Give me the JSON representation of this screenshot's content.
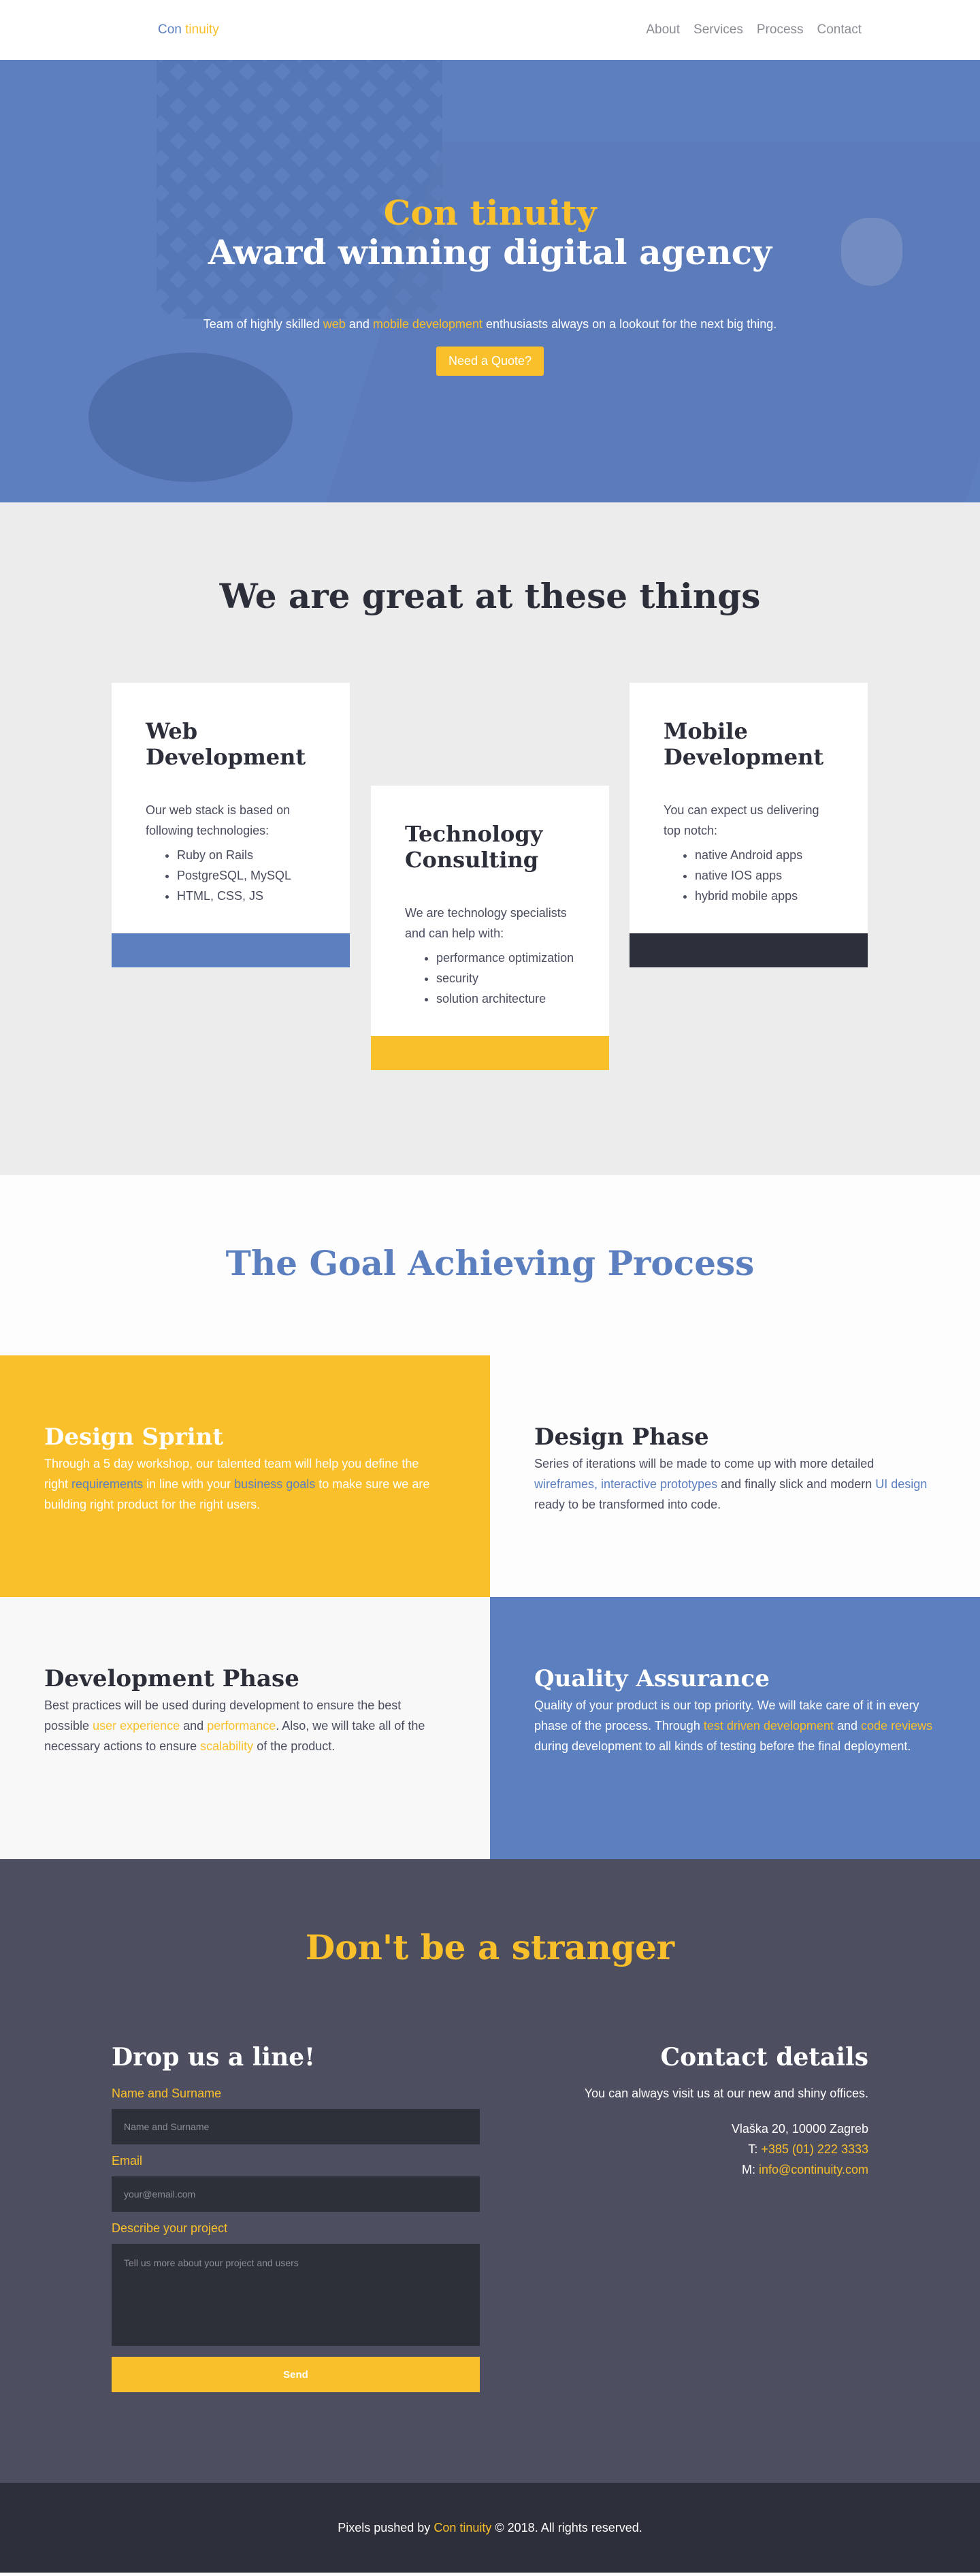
{
  "nav": {
    "logo_part1": "Con",
    "logo_part2": "tinuity",
    "links": [
      "About",
      "Services",
      "Process",
      "Contact"
    ]
  },
  "hero": {
    "title_line1": "Con tinuity",
    "title_line2": "Award winning digital agency",
    "tagline_pre": "Team of highly skilled",
    "tagline_hl1": "web",
    "tagline_mid": "and",
    "tagline_hl2": "mobile development",
    "tagline_post": "enthusiasts always on a lookout for the next big thing.",
    "cta": "Need a Quote?"
  },
  "services": {
    "title": "We are great at these things",
    "cards": [
      {
        "title": "Web Development",
        "desc": "Our web stack is based on following technologies:",
        "items": [
          "Ruby on Rails",
          "PostgreSQL, MySQL",
          "HTML, CSS, JS"
        ]
      },
      {
        "title": "Technology Consulting",
        "desc": "We are technology specialists and can help with:",
        "items": [
          "performance optimization",
          "security",
          "solution architecture"
        ]
      },
      {
        "title": "Mobile Development",
        "desc": "You can expect us delivering top notch:",
        "items": [
          "native Android apps",
          "native IOS apps",
          "hybrid mobile apps"
        ]
      }
    ]
  },
  "process": {
    "title": "The Goal Achieving Process",
    "sprint": {
      "title": "Design Sprint",
      "t1": "Through a 5 day workshop, our talented team will help you define the right",
      "h1": "requirements",
      "t2": "in line with your",
      "h2": "business goals",
      "t3": "to make sure we are building right product for the right users."
    },
    "design": {
      "title": "Design Phase",
      "t1": "Series of iterations will be made to come up with more detailed",
      "h1": "wireframes, interactive prototypes",
      "t2": "and finally slick and modern",
      "h2": "UI design",
      "t3": "ready to be transformed into code."
    },
    "development": {
      "title": "Development Phase",
      "t1": "Best practices will be used during development to ensure the best possible",
      "h1": "user experience",
      "t2": "and",
      "h2": "performance",
      "t3": ". Also, we will take all of the necessary actions to ensure",
      "h3": "scalability",
      "t4": "of the product."
    },
    "qa": {
      "title": "Quality Assurance",
      "t1": "Quality of your product is our top priority. We will take care of it in every phase of the process. Through",
      "h1": "test driven development",
      "t2": "and",
      "h2": "code reviews",
      "t3": "during development to all kinds of testing before the final deployment."
    }
  },
  "contact": {
    "title": "Don't be a stranger",
    "form": {
      "title": "Drop us a line!",
      "name_label": "Name and Surname",
      "name_placeholder": "Name and Surname",
      "email_label": "Email",
      "email_placeholder": "your@email.com",
      "project_label": "Describe your project",
      "project_placeholder": "Tell us more about your project and users",
      "send": "Send"
    },
    "details": {
      "title": "Contact details",
      "intro": "You can always visit us at our new and shiny offices.",
      "address": "Vlaška 20, 10000 Zagreb",
      "phone_prefix": "T:",
      "phone": "+385 (01) 222 3333",
      "mail_prefix": "M:",
      "mail": "info@continuity.com"
    }
  },
  "footer": {
    "pre": "Pixels pushed by",
    "brand": "Con tinuity",
    "post": "© 2018. All rights reserved."
  },
  "colors": {
    "accent_yellow": "#f9c02c",
    "accent_blue": "#5b7fbf",
    "dark": "#2d2f3a",
    "contact_bg": "#4d4f61"
  }
}
